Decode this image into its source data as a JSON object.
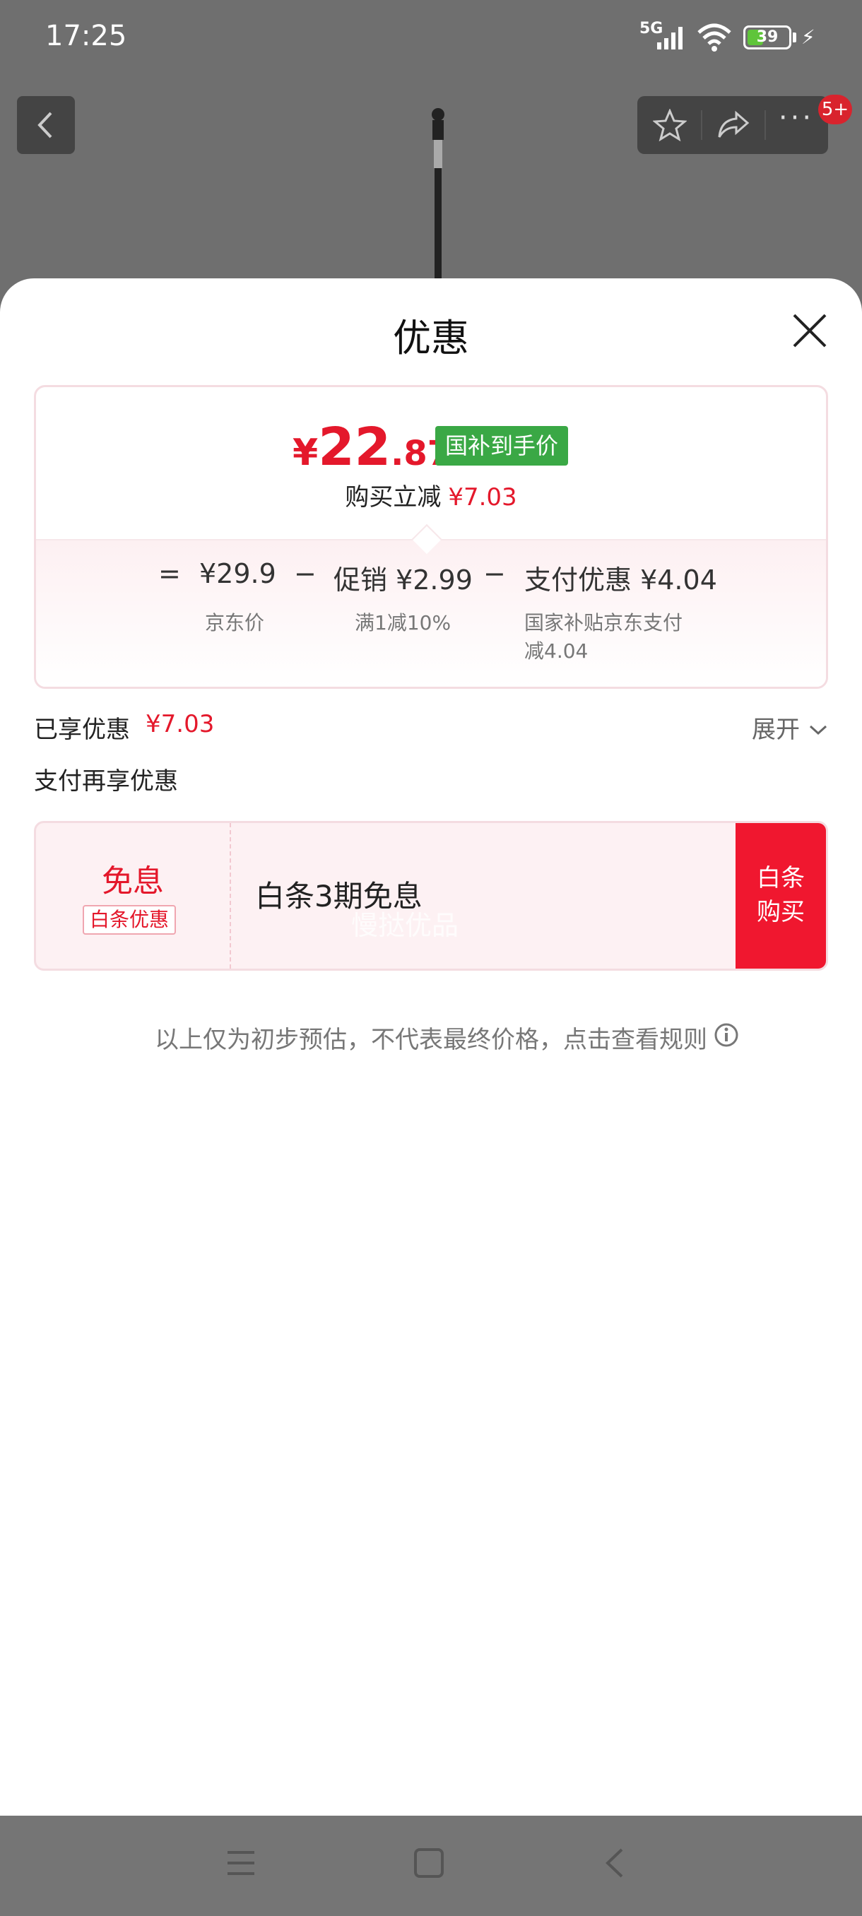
{
  "status_bar": {
    "time": "17:25",
    "network": "5G",
    "battery": "39",
    "battery_level": 0.39
  },
  "header": {
    "badge": "5+"
  },
  "sheet": {
    "title": "优惠",
    "price": {
      "symbol": "¥",
      "integer": "22",
      "decimal": ".87",
      "tag": "国补到手价"
    },
    "reduce": {
      "label": "购买立减",
      "amount": "¥7.03"
    },
    "formula": [
      {
        "op": "=",
        "value": "¥29.9",
        "desc": "京东价"
      },
      {
        "op": "−",
        "value": "促销 ¥2.99",
        "desc": "满1减10%"
      },
      {
        "op": "−",
        "value": "支付优惠 ¥4.04",
        "desc_line1": "国家补贴京东支付",
        "desc_line2": "减4.04"
      }
    ],
    "enjoyed": {
      "label": "已享优惠",
      "amount": "¥7.03",
      "expand": "展开"
    },
    "pay_more_label": "支付再享优惠",
    "coupon": {
      "main": "免息",
      "tag": "白条优惠",
      "desc": "白条3期免息",
      "watermark": "慢挞优品",
      "button_line1": "白条",
      "button_line2": "购买"
    },
    "note": "以上仅为初步预估，不代表最终价格，点击查看规则"
  },
  "colors": {
    "accent": "#e4182b",
    "green_tag": "#3aa845",
    "button": "#f0172f"
  }
}
